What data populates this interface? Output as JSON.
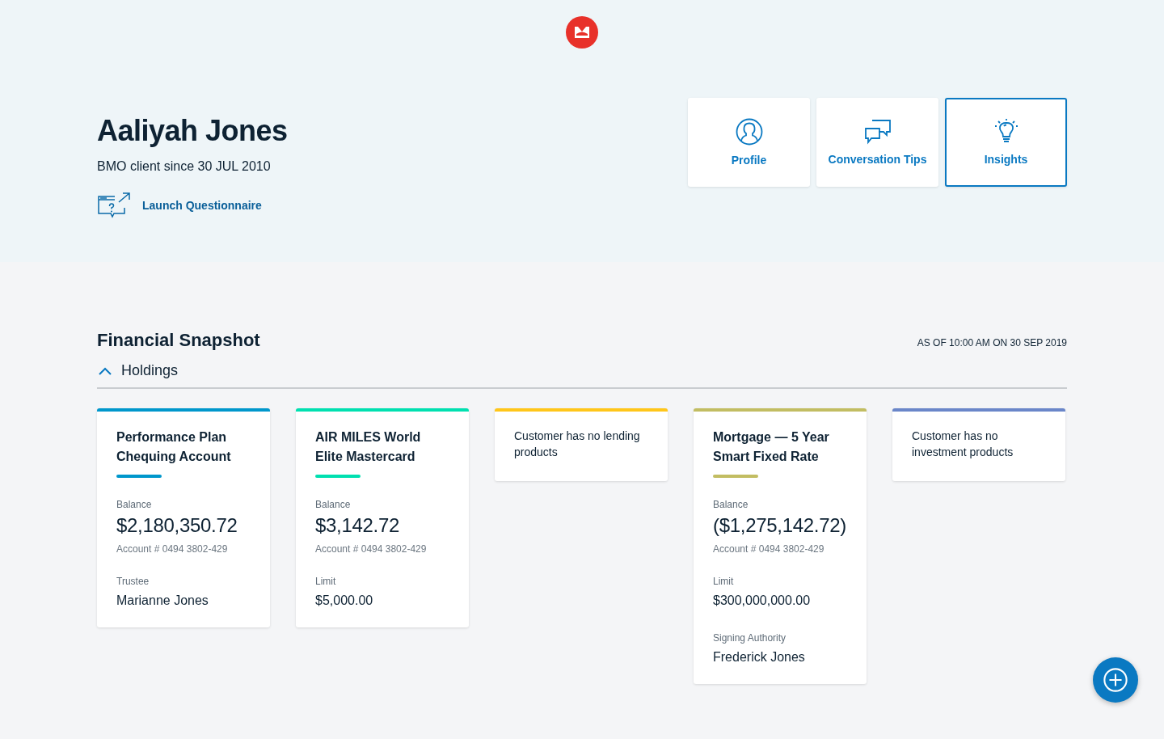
{
  "client": {
    "name": "Aaliyah Jones",
    "since": "BMO client since 30 JUL 2010",
    "questionnaire_link": "Launch Questionnaire"
  },
  "nav_tiles": [
    {
      "label": "Profile",
      "kind": "profile",
      "selected": false
    },
    {
      "label": "Conversation Tips",
      "kind": "tips",
      "selected": false
    },
    {
      "label": "Insights",
      "kind": "insights",
      "selected": true
    }
  ],
  "snapshot": {
    "title": "Financial Snapshot",
    "as_of": "AS OF 10:00 AM ON 30 SEP 2019",
    "section": {
      "label": "Holdings",
      "expanded": true
    }
  },
  "cards": [
    {
      "kind": "account",
      "color": "#0097cc",
      "title": "Performance Plan Chequing Account",
      "balance_label": "Balance",
      "balance": "$2,180,350.72",
      "account": "Account # 0494 3802-429",
      "fields": [
        {
          "label": "Trustee",
          "value": "Marianne Jones"
        }
      ]
    },
    {
      "kind": "account",
      "color": "#00e0b0",
      "title": "AIR MILES World Elite Mastercard",
      "balance_label": "Balance",
      "balance": "$3,142.72",
      "account": "Account # 0494 3802-429",
      "fields": [
        {
          "label": "Limit",
          "value": "$5,000.00"
        }
      ]
    },
    {
      "kind": "empty",
      "color": "#ffc61a",
      "message": "Customer has no lending products"
    },
    {
      "kind": "account",
      "color": "#c2bd62",
      "title": "Mortgage — 5 Year Smart Fixed Rate",
      "balance_label": "Balance",
      "balance": "($1,275,142.72)",
      "account": "Account # 0494 3802-429",
      "fields": [
        {
          "label": "Limit",
          "value": "$300,000,000.00"
        },
        {
          "label": "Signing Authority",
          "value": "Frederick Jones"
        }
      ]
    },
    {
      "kind": "empty",
      "color": "#6a86c9",
      "message": "Customer has no investment products"
    }
  ]
}
